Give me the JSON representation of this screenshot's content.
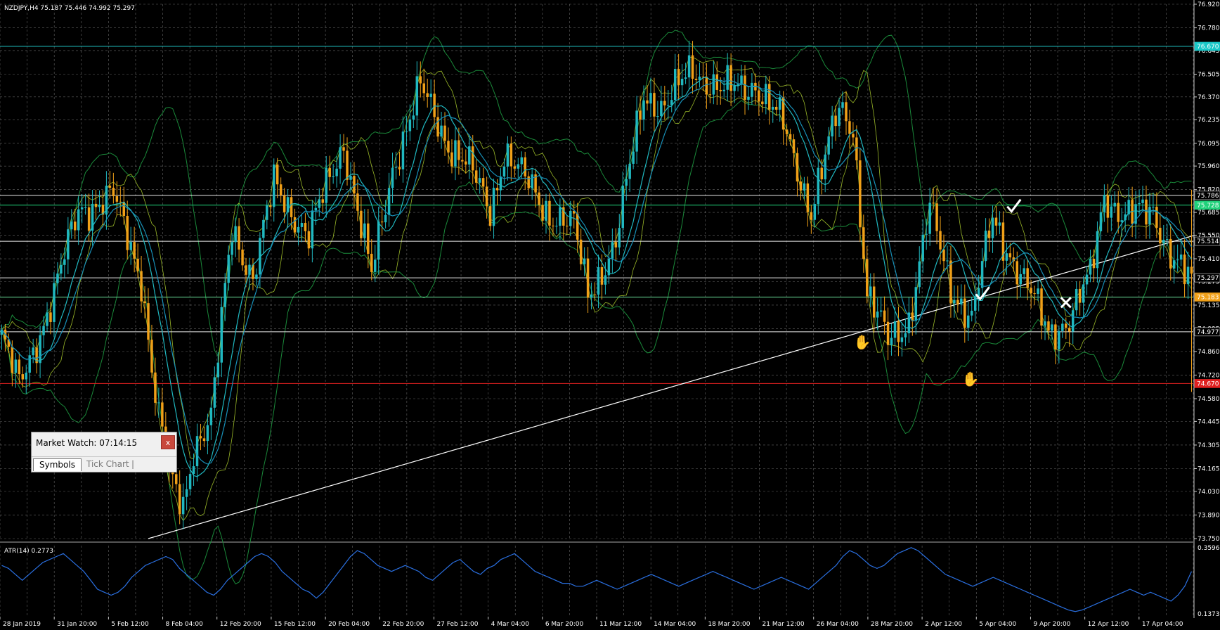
{
  "header": {
    "symbol_info": "NZDJPY,H4  75.187 75.446 74.992 75.297"
  },
  "price_axis": {
    "ticks": [
      "76.920",
      "76.780",
      "76.645",
      "76.505",
      "76.370",
      "76.235",
      "76.095",
      "75.960",
      "75.820",
      "75.685",
      "75.550",
      "75.410",
      "75.275",
      "75.135",
      "74.995",
      "74.860",
      "74.720",
      "74.580",
      "74.445",
      "74.305",
      "74.165",
      "74.030",
      "73.890",
      "73.750"
    ],
    "range": [
      73.75,
      76.92
    ],
    "level_labels": [
      {
        "text": "76.670",
        "price": 76.67,
        "bg": "#19c8c8",
        "fg": "#000000"
      },
      {
        "text": "75.786",
        "price": 75.786,
        "bg": "#000000",
        "fg": "#ffffff"
      },
      {
        "text": "75.728",
        "price": 75.728,
        "bg": "#1fd17a",
        "fg": "#000000"
      },
      {
        "text": "75.514",
        "price": 75.514,
        "bg": "#000000",
        "fg": "#ffffff"
      },
      {
        "text": "75.297",
        "price": 75.297,
        "bg": "#000000",
        "fg": "#ffffff"
      },
      {
        "text": "75.183",
        "price": 75.183,
        "bg": "#f0a018",
        "fg": "#000000"
      },
      {
        "text": "74.977",
        "price": 74.977,
        "bg": "#000000",
        "fg": "#ffffff"
      },
      {
        "text": "74.670",
        "price": 74.67,
        "bg": "#e02020",
        "fg": "#000000"
      }
    ]
  },
  "time_axis": {
    "labels": [
      "28 Jan 2019",
      "31 Jan 20:00",
      "5 Feb 12:00",
      "8 Feb 04:00",
      "12 Feb 20:00",
      "15 Feb 12:00",
      "20 Feb 04:00",
      "22 Feb 20:00",
      "27 Feb 12:00",
      "4 Mar 04:00",
      "6 Mar 20:00",
      "11 Mar 12:00",
      "14 Mar 04:00",
      "18 Mar 20:00",
      "21 Mar 12:00",
      "26 Mar 04:00",
      "28 Mar 20:00",
      "2 Apr 12:00",
      "5 Apr 04:00",
      "9 Apr 20:00",
      "12 Apr 12:00",
      "17 Apr 04:00"
    ]
  },
  "horizontal_lines": [
    {
      "price": 76.67,
      "color": "#1fc8c8"
    },
    {
      "price": 75.786,
      "color": "#e8e8e8"
    },
    {
      "price": 75.728,
      "color": "#1fd17a"
    },
    {
      "price": 75.514,
      "color": "#e8e8e8"
    },
    {
      "price": 75.297,
      "color": "#e8e8e8"
    },
    {
      "price": 75.183,
      "color": "#6fe8a0"
    },
    {
      "price": 74.977,
      "color": "#e8e8e8"
    },
    {
      "price": 74.67,
      "color": "#e02020"
    }
  ],
  "trendline": {
    "color": "#ffffff",
    "from": {
      "bar": 42,
      "price": 73.75
    },
    "to": {
      "bar": 342,
      "price": 75.55
    }
  },
  "indicator": {
    "label": "ATR(14) 0.2773",
    "ticks": [
      "0.3596",
      "0.1373"
    ],
    "range": [
      0.1373,
      0.3596
    ],
    "color": "#2a6fe0",
    "values": [
      0.3,
      0.29,
      0.27,
      0.25,
      0.27,
      0.29,
      0.31,
      0.32,
      0.33,
      0.34,
      0.32,
      0.3,
      0.28,
      0.25,
      0.22,
      0.21,
      0.2,
      0.21,
      0.23,
      0.26,
      0.28,
      0.3,
      0.31,
      0.32,
      0.33,
      0.32,
      0.29,
      0.27,
      0.25,
      0.23,
      0.21,
      0.2,
      0.22,
      0.25,
      0.27,
      0.29,
      0.31,
      0.33,
      0.34,
      0.33,
      0.31,
      0.28,
      0.26,
      0.24,
      0.22,
      0.21,
      0.19,
      0.21,
      0.24,
      0.27,
      0.3,
      0.33,
      0.35,
      0.34,
      0.32,
      0.3,
      0.29,
      0.28,
      0.29,
      0.3,
      0.29,
      0.28,
      0.26,
      0.25,
      0.27,
      0.29,
      0.31,
      0.32,
      0.3,
      0.28,
      0.27,
      0.29,
      0.3,
      0.32,
      0.33,
      0.34,
      0.32,
      0.3,
      0.28,
      0.27,
      0.26,
      0.25,
      0.24,
      0.24,
      0.23,
      0.23,
      0.24,
      0.25,
      0.24,
      0.23,
      0.22,
      0.23,
      0.24,
      0.25,
      0.26,
      0.27,
      0.26,
      0.25,
      0.24,
      0.23,
      0.24,
      0.25,
      0.26,
      0.27,
      0.28,
      0.27,
      0.26,
      0.25,
      0.24,
      0.23,
      0.22,
      0.23,
      0.24,
      0.25,
      0.26,
      0.25,
      0.24,
      0.23,
      0.22,
      0.24,
      0.26,
      0.28,
      0.3,
      0.33,
      0.35,
      0.34,
      0.32,
      0.3,
      0.29,
      0.3,
      0.32,
      0.34,
      0.35,
      0.36,
      0.35,
      0.33,
      0.31,
      0.29,
      0.27,
      0.26,
      0.25,
      0.24,
      0.23,
      0.24,
      0.25,
      0.26,
      0.25,
      0.24,
      0.23,
      0.22,
      0.21,
      0.2,
      0.19,
      0.18,
      0.17,
      0.16,
      0.15,
      0.145,
      0.15,
      0.16,
      0.17,
      0.18,
      0.19,
      0.2,
      0.21,
      0.22,
      0.21,
      0.2,
      0.21,
      0.2,
      0.19,
      0.18,
      0.2,
      0.23,
      0.28
    ]
  },
  "annotations": [
    {
      "type": "check",
      "bar": 290,
      "price": 75.72
    },
    {
      "type": "check",
      "bar": 281,
      "price": 75.2
    },
    {
      "type": "cross",
      "bar": 305,
      "price": 75.15
    },
    {
      "type": "thumb",
      "bar": 246,
      "price": 74.92
    },
    {
      "type": "thumb",
      "bar": 277,
      "price": 74.7
    }
  ],
  "market_watch": {
    "title": "Market Watch: 07:14:15",
    "close_label": "x",
    "tab_symbols": "Symbols",
    "tab_tick_chart": "Tick Chart",
    "tab_separator": "|"
  },
  "colors": {
    "bull_candle": "#20b8c0",
    "bear_candle": "#f0a018",
    "ma_fast": "#20b8c0",
    "ma_slow": "#1890b8",
    "bands_outer": "#1a8a3a",
    "bands_inner": "#9ab828",
    "grid": "#b8b8b8"
  }
}
